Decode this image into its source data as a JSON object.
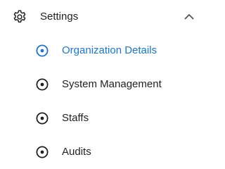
{
  "section": {
    "label": "Settings",
    "icon": "gear-icon",
    "expanded": true,
    "chevron_icon": "chevron-up-icon"
  },
  "items": [
    {
      "label": "Organization Details",
      "icon": "radio-dot-icon",
      "active": true
    },
    {
      "label": "System Management",
      "icon": "radio-dot-icon",
      "active": false
    },
    {
      "label": "Staffs",
      "icon": "radio-dot-icon",
      "active": false
    },
    {
      "label": "Audits",
      "icon": "radio-dot-icon",
      "active": false
    }
  ],
  "colors": {
    "active": "#1976d2",
    "text": "#222222",
    "icon": "#222222",
    "chevron": "#555555",
    "background": "#ffffff"
  }
}
